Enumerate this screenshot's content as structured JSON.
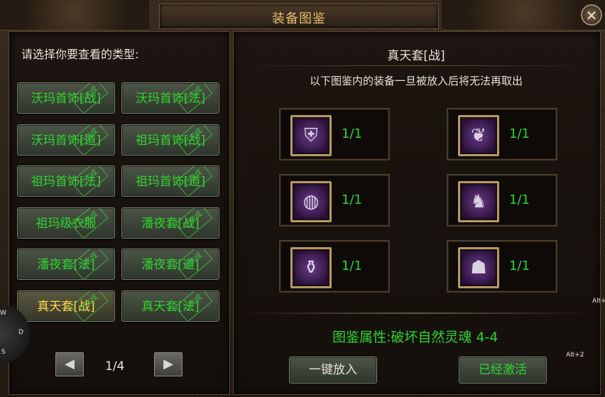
{
  "window": {
    "title": "装备图鉴",
    "close_glyph": "✕"
  },
  "left": {
    "prompt": "请选择你要查看的类型:",
    "stamp_text": "已完成",
    "types": [
      {
        "label": "沃玛首饰[战]",
        "selected": false
      },
      {
        "label": "沃玛首饰[法]",
        "selected": false
      },
      {
        "label": "沃玛首饰[道]",
        "selected": false
      },
      {
        "label": "祖玛首饰[战]",
        "selected": false
      },
      {
        "label": "祖玛首饰[法]",
        "selected": false
      },
      {
        "label": "祖玛首饰[道]",
        "selected": false
      },
      {
        "label": "祖玛级衣服",
        "selected": false
      },
      {
        "label": "潘夜套[战]",
        "selected": false
      },
      {
        "label": "潘夜套[法]",
        "selected": false
      },
      {
        "label": "潘夜套[道]",
        "selected": false
      },
      {
        "label": "真天套[战]",
        "selected": true
      },
      {
        "label": "真天套[法]",
        "selected": false
      }
    ],
    "pager": {
      "prev_glyph": "◀",
      "next_glyph": "▶",
      "page": "1/4"
    }
  },
  "right": {
    "set_name": "真天套[战]",
    "notice": "以下图鉴内的装备一旦被放入后将无法再取出",
    "items": [
      {
        "icon": "armor-icon",
        "glyph": "⛨",
        "count": "1/1"
      },
      {
        "icon": "gem-icon",
        "glyph": "❦",
        "count": "1/1"
      },
      {
        "icon": "ring-icon",
        "glyph": "◍",
        "count": "1/1"
      },
      {
        "icon": "figure-icon",
        "glyph": "♞",
        "count": "1/1"
      },
      {
        "icon": "bracelet-icon",
        "glyph": "⚱",
        "count": "1/1"
      },
      {
        "icon": "boots-icon",
        "glyph": "☗",
        "count": "1/1"
      }
    ],
    "attribute": "图鉴属性:破坏自然灵魂 4-4",
    "buttons": {
      "deposit": "一键放入",
      "activated": "已经激活"
    }
  },
  "hints": {
    "alt1": "Alt+",
    "alt2": "Alt+2",
    "w": "W",
    "d": "D",
    "s": "S"
  },
  "colors": {
    "green_text": "#2fd42f",
    "selected_text": "#ffd94a",
    "title_gold": "#e0bc6a"
  }
}
